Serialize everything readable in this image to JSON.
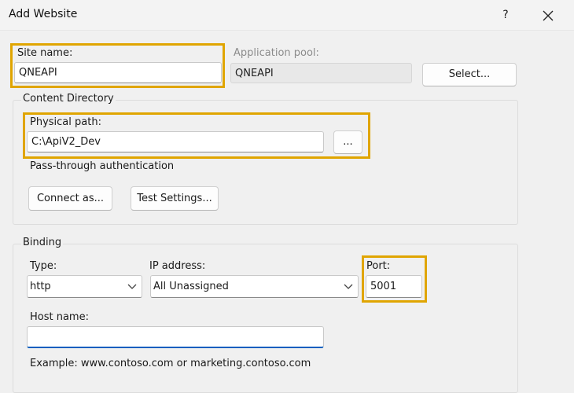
{
  "window": {
    "title": "Add Website",
    "help_label": "?",
    "close_icon": "close-icon"
  },
  "site": {
    "site_name_label": "Site name:",
    "site_name_value": "QNEAPI",
    "app_pool_label": "Application pool:",
    "app_pool_value": "QNEAPI",
    "select_button_label": "Select..."
  },
  "content_directory": {
    "group_label": "Content Directory",
    "physical_path_label": "Physical path:",
    "physical_path_value": "C:\\ApiV2_Dev",
    "browse_button_label": "...",
    "pass_through_label": "Pass-through authentication",
    "connect_as_label": "Connect as...",
    "test_settings_label": "Test Settings..."
  },
  "binding": {
    "group_label": "Binding",
    "type_label": "Type:",
    "type_value": "http",
    "ip_label": "IP address:",
    "ip_value": "All Unassigned",
    "port_label": "Port:",
    "port_value": "5001",
    "host_name_label": "Host name:",
    "host_name_value": "",
    "example_text": "Example: www.contoso.com or marketing.contoso.com"
  },
  "colors": {
    "highlight": "#e0a500",
    "focus_underline": "#0a5fbf",
    "dialog_background": "#f0f0f0"
  }
}
